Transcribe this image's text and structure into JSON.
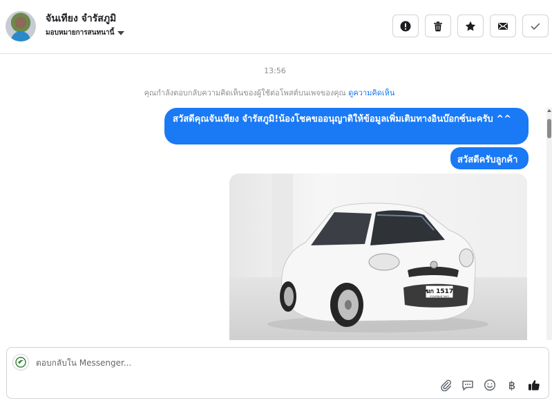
{
  "header": {
    "contact_name": "จันเทียง จำรัสภูมิ",
    "assign_label": "มอบหมายการสนทนานี้",
    "actions": [
      {
        "name": "report-button",
        "icon": "alert-circle-icon"
      },
      {
        "name": "delete-button",
        "icon": "trash-icon"
      },
      {
        "name": "star-button",
        "icon": "star-icon"
      },
      {
        "name": "mark-unread-button",
        "icon": "envelope-icon"
      },
      {
        "name": "mark-done-button",
        "icon": "check-icon"
      }
    ]
  },
  "thread": {
    "timestamp": "13:56",
    "context_text": "คุณกำลังตอบกลับความคิดเห็นของผู้ใช้ต่อโพสต์บนเพจของคุณ",
    "context_link": "ดูความคิดเห็น",
    "messages": [
      {
        "text": "สวัสดีคุณจันเทียง จำรัสภูมิ!น้องโชคขออนุญาติให้ข้อมูลเพิ่มเติมทางอินบ๊อกซ์นะครับ ^^"
      },
      {
        "text": "สวัสดีครับลูกค้า"
      }
    ],
    "photo": {
      "plate_text": "ฆก 1517",
      "plate_sub": "กรุงเทพมหานคร"
    }
  },
  "composer": {
    "placeholder": "ตอบกลับใน Messenger...",
    "tools": [
      {
        "name": "attach-button",
        "icon": "paperclip-icon"
      },
      {
        "name": "saved-replies-button",
        "icon": "chat-bubble-icon"
      },
      {
        "name": "emoji-button",
        "icon": "smiley-icon"
      },
      {
        "name": "payment-button",
        "icon": "baht-icon",
        "label": "฿"
      },
      {
        "name": "like-button",
        "icon": "thumbs-up-icon"
      }
    ]
  },
  "colors": {
    "accent": "#1a79f5",
    "link": "#1877f2",
    "muted": "#8a8d91"
  }
}
